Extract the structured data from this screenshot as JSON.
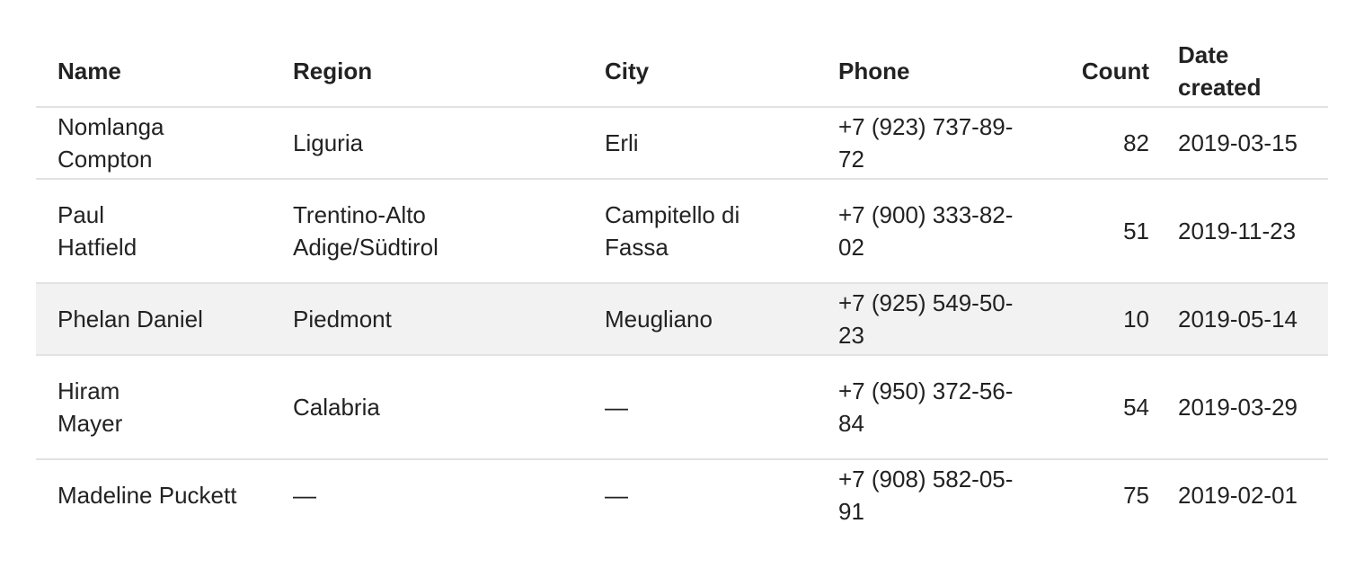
{
  "columns": {
    "name": "Name",
    "region": "Region",
    "city": "City",
    "phone": "Phone",
    "count": "Count",
    "date": "Date created"
  },
  "rows": [
    {
      "name_first": "Nomlanga Compton",
      "name_second": "",
      "region": "Liguria",
      "city": "Erli",
      "phone": "+7 (923) 737-89-72",
      "count": "82",
      "date": "2019-03-15"
    },
    {
      "name_first": "Paul",
      "name_second": "Hatfield",
      "region": "Trentino-Alto Adige/Südtirol",
      "city": "Campitello di Fassa",
      "phone": "+7 (900) 333-82-02",
      "count": "51",
      "date": "2019-11-23"
    },
    {
      "name_first": "Phelan Daniel",
      "name_second": "",
      "region": "Piedmont",
      "city": "Meugliano",
      "phone": "+7 (925) 549-50-23",
      "count": "10",
      "date": "2019-05-14"
    },
    {
      "name_first": "Hiram",
      "name_second": "Mayer",
      "region": "Calabria",
      "city": "—",
      "phone": "+7 (950) 372-56-84",
      "count": "54",
      "date": "2019-03-29"
    },
    {
      "name_first": "Madeline Puckett",
      "name_second": "",
      "region": "—",
      "city": "—",
      "phone": "+7 (908) 582-05-91",
      "count": "75",
      "date": "2019-02-01"
    }
  ],
  "colors": {
    "text": "#222222",
    "divider": "#e2e2e2",
    "highlight_row": "#f2f2f2"
  }
}
